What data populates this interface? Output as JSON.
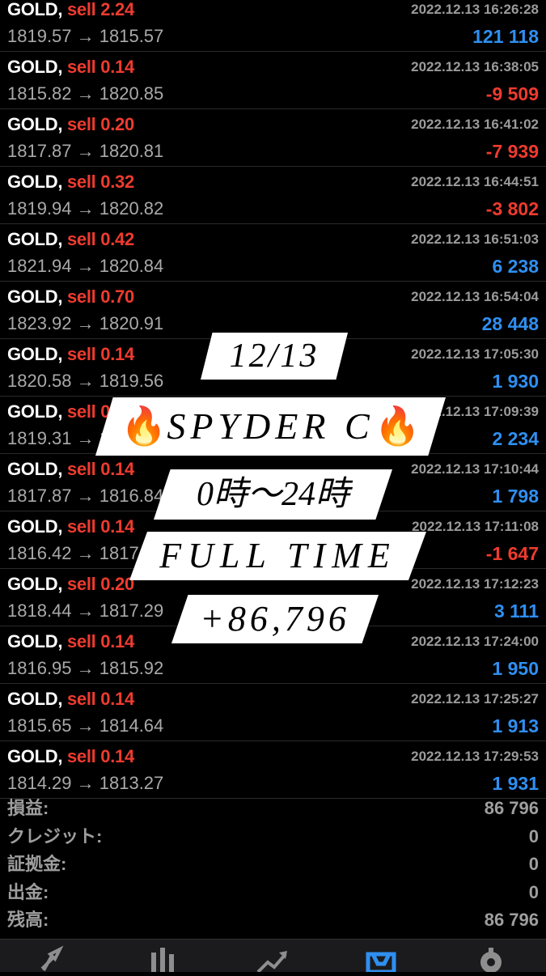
{
  "trades": [
    {
      "symbol": "GOLD,",
      "side": "sell 2.24",
      "time": "2022.12.13 16:26:28",
      "price": "1819.57 → 1815.57",
      "pnl": "121 118",
      "sign": "pos"
    },
    {
      "symbol": "GOLD,",
      "side": "sell 0.14",
      "time": "2022.12.13 16:38:05",
      "price": "1815.82 → 1820.85",
      "pnl": "-9 509",
      "sign": "neg"
    },
    {
      "symbol": "GOLD,",
      "side": "sell 0.20",
      "time": "2022.12.13 16:41:02",
      "price": "1817.87 → 1820.81",
      "pnl": "-7 939",
      "sign": "neg"
    },
    {
      "symbol": "GOLD,",
      "side": "sell 0.32",
      "time": "2022.12.13 16:44:51",
      "price": "1819.94 → 1820.82",
      "pnl": "-3 802",
      "sign": "neg"
    },
    {
      "symbol": "GOLD,",
      "side": "sell 0.42",
      "time": "2022.12.13 16:51:03",
      "price": "1821.94 → 1820.84",
      "pnl": "6 238",
      "sign": "pos"
    },
    {
      "symbol": "GOLD,",
      "side": "sell 0.70",
      "time": "2022.12.13 16:54:04",
      "price": "1823.92 → 1820.91",
      "pnl": "28 448",
      "sign": "pos"
    },
    {
      "symbol": "GOLD,",
      "side": "sell 0.14",
      "time": "2022.12.13 17:05:30",
      "price": "1820.58 → 1819.56",
      "pnl": "1 930",
      "sign": "pos"
    },
    {
      "symbol": "GOLD,",
      "side": "sell 0.14",
      "time": "2022.12.13 17:09:39",
      "price": "1819.31 → 1818.29",
      "pnl": "2 234",
      "sign": "pos"
    },
    {
      "symbol": "GOLD,",
      "side": "sell 0.14",
      "time": "2022.12.13 17:10:44",
      "price": "1817.87 → 1816.84",
      "pnl": "1 798",
      "sign": "pos"
    },
    {
      "symbol": "GOLD,",
      "side": "sell 0.14",
      "time": "2022.12.13 17:11:08",
      "price": "1816.42 → 1817.36",
      "pnl": "-1 647",
      "sign": "neg"
    },
    {
      "symbol": "GOLD,",
      "side": "sell 0.20",
      "time": "2022.12.13 17:12:23",
      "price": "1818.44 → 1817.29",
      "pnl": "3 111",
      "sign": "pos"
    },
    {
      "symbol": "GOLD,",
      "side": "sell 0.14",
      "time": "2022.12.13 17:24:00",
      "price": "1816.95 → 1815.92",
      "pnl": "1 950",
      "sign": "pos"
    },
    {
      "symbol": "GOLD,",
      "side": "sell 0.14",
      "time": "2022.12.13 17:25:27",
      "price": "1815.65 → 1814.64",
      "pnl": "1 913",
      "sign": "pos"
    },
    {
      "symbol": "GOLD,",
      "side": "sell 0.14",
      "time": "2022.12.13 17:29:53",
      "price": "1814.29 → 1813.27",
      "pnl": "1 931",
      "sign": "pos"
    }
  ],
  "summary": [
    {
      "label": "損益:",
      "value": "86 796"
    },
    {
      "label": "クレジット:",
      "value": "0"
    },
    {
      "label": "証拠金:",
      "value": "0"
    },
    {
      "label": "出金:",
      "value": "0"
    },
    {
      "label": "残高:",
      "value": "86 796"
    }
  ],
  "overlay": {
    "date": "12/13",
    "name": "SPYDER C",
    "hours": "0時〜24時",
    "full_time": "FULL TIME",
    "result": "+86,796"
  },
  "colors": {
    "profit": "#2f8ff1",
    "loss": "#ef3b2e",
    "accent": "#2f8ff1"
  },
  "tabs": [
    {
      "icon": "quotes-icon"
    },
    {
      "icon": "chart-icon"
    },
    {
      "icon": "trade-icon"
    },
    {
      "icon": "history-icon",
      "active": true
    },
    {
      "icon": "settings-icon"
    }
  ]
}
